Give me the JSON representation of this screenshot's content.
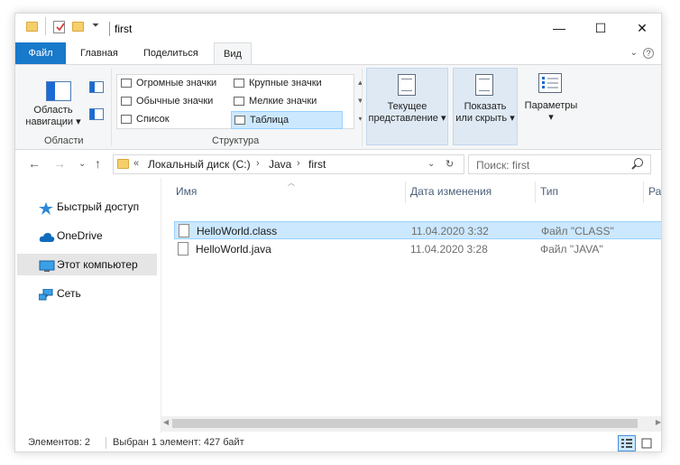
{
  "window": {
    "title": "first",
    "controls": {
      "minimize": "—",
      "maximize": "☐",
      "close": "✕"
    }
  },
  "tabs": [
    {
      "label": "Файл"
    },
    {
      "label": "Главная"
    },
    {
      "label": "Поделиться"
    },
    {
      "label": "Вид"
    }
  ],
  "ribbon": {
    "panes": {
      "nav_pane_line1": "Область",
      "nav_pane_line2": "навигации",
      "group_label": "Области"
    },
    "layout": {
      "items": [
        {
          "label": "Огромные значки"
        },
        {
          "label": "Крупные значки"
        },
        {
          "label": "Обычные значки"
        },
        {
          "label": "Мелкие значки"
        },
        {
          "label": "Список"
        },
        {
          "label": "Таблица",
          "selected": true
        }
      ],
      "group_label": "Структура"
    },
    "current_view": {
      "line1": "Текущее",
      "line2": "представление"
    },
    "show_hide": {
      "line1": "Показать",
      "line2": "или скрыть"
    },
    "options": {
      "label": "Параметры"
    }
  },
  "address": {
    "prefix": "«",
    "crumbs": [
      "Локальный диск (C:)",
      "Java",
      "first"
    ],
    "separator": "›"
  },
  "search": {
    "placeholder": "Поиск: first"
  },
  "nav_pane": {
    "items": [
      {
        "label": "Быстрый доступ",
        "icon": "star-icon"
      },
      {
        "label": "OneDrive",
        "icon": "cloud-icon"
      },
      {
        "label": "Этот компьютер",
        "icon": "computer-icon",
        "selected": true
      },
      {
        "label": "Сеть",
        "icon": "network-icon"
      }
    ]
  },
  "file_list": {
    "columns": [
      "Имя",
      "Дата изменения",
      "Тип",
      "Ра"
    ],
    "rows": [
      {
        "name": "HelloWorld.class",
        "date": "11.04.2020 3:32",
        "type": "Файл \"CLASS\"",
        "selected": true
      },
      {
        "name": "HelloWorld.java",
        "date": "11.04.2020 3:28",
        "type": "Файл \"JAVA\""
      }
    ]
  },
  "status": {
    "count": "Элементов: 2",
    "selection": "Выбран 1 элемент: 427 байт"
  },
  "colors": {
    "accent": "#1979ca",
    "selection": "#cce8ff",
    "folder": "#f5cf6a"
  }
}
